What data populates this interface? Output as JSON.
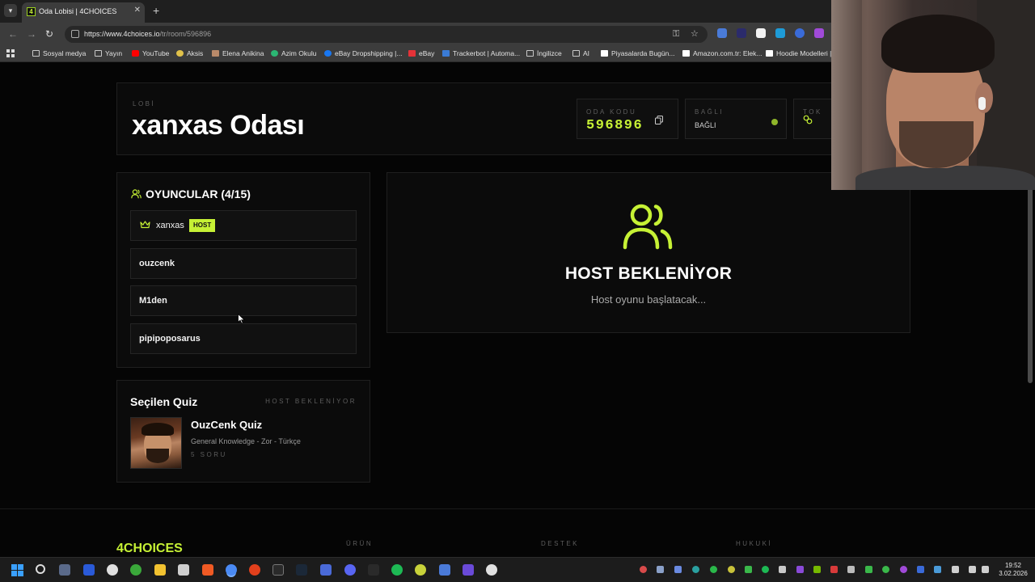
{
  "browser": {
    "tab_title": "Oda Lobisi | 4CHOICES",
    "tab_favicon": "4",
    "url_host": "https://www.4choices.io",
    "url_path": "/tr/room/596896"
  },
  "bookmarks": [
    {
      "label": "Sosyal medya",
      "icon": "folder-icon",
      "color": "#c9c9c9"
    },
    {
      "label": "Yayın",
      "icon": "folder-icon",
      "color": "#c9c9c9"
    },
    {
      "label": "YouTube",
      "icon": "youtube-icon",
      "color": "#ff0000"
    },
    {
      "label": "Aksis",
      "icon": "aksis-icon",
      "color": "#e0c14a"
    },
    {
      "label": "Elena Anikina",
      "icon": "avatar-icon",
      "color": "#b98a6a"
    },
    {
      "label": "Azim Okulu",
      "icon": "azim-icon",
      "color": "#2bb673"
    },
    {
      "label": "eBay Dropshipping |...",
      "icon": "facebook-icon",
      "color": "#1877f2"
    },
    {
      "label": "eBay",
      "icon": "ebay-icon",
      "color": "#e53238"
    },
    {
      "label": "Trackerbot | Automa...",
      "icon": "trackerbot-icon",
      "color": "#3a7bd5"
    },
    {
      "label": "İngilizce",
      "icon": "folder-icon",
      "color": "#c9c9c9"
    },
    {
      "label": "AI",
      "icon": "folder-icon",
      "color": "#c9c9c9"
    },
    {
      "label": "Piyasalarda Bugün...",
      "icon": "tradingview-icon",
      "color": "#ffffff"
    },
    {
      "label": "Amazon.com.tr: Elek...",
      "icon": "amazon-icon",
      "color": "#ffffff"
    },
    {
      "label": "Hoodie Modelleri |",
      "icon": "hoodie-icon",
      "color": "#ffffff"
    }
  ],
  "lobby": {
    "eyebrow": "LOBİ",
    "title": "xanxas Odası"
  },
  "stats": {
    "room_code_label": "ODA KODU",
    "room_code": "596896",
    "connection_label": "BAĞLI",
    "connection_value": "BAĞLI",
    "token_label": "TOK"
  },
  "players": {
    "title": "OYUNCULAR (4/15)",
    "host_badge": "HOST",
    "list": [
      {
        "name": "xanxas"
      },
      {
        "name": "ouzcenk"
      },
      {
        "name": "M1den"
      },
      {
        "name": "pipipoposarus"
      }
    ]
  },
  "waiting": {
    "title": "HOST BEKLENİYOR",
    "subtitle": "Host oyunu başlatacak..."
  },
  "quiz": {
    "header": "Seçilen Quiz",
    "status": "HOST BEKLENİYOR",
    "name": "OuzCenk Quiz",
    "meta": "General Knowledge - Zor - Türkçe",
    "count": "5 SORU"
  },
  "footer": {
    "brand": "4CHOICES",
    "columns": [
      "ÜRÜN",
      "DESTEK",
      "HUKUKİ"
    ]
  },
  "taskbar": {
    "time": "19:52",
    "date": "3.02.2026"
  },
  "colors": {
    "accent": "#c6f135",
    "background": "#050505",
    "card": "#0b0b0b",
    "live": "#8fb62a"
  }
}
